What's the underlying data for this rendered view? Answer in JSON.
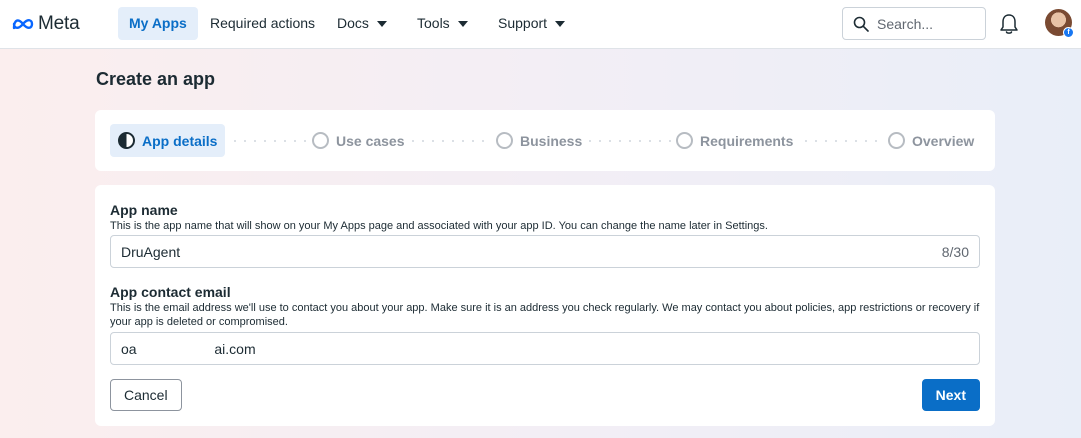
{
  "nav": {
    "brand": "Meta",
    "items": [
      {
        "label": "My Apps",
        "active": true,
        "dropdown": false
      },
      {
        "label": "Required actions",
        "active": false,
        "dropdown": false
      },
      {
        "label": "Docs",
        "active": false,
        "dropdown": true
      },
      {
        "label": "Tools",
        "active": false,
        "dropdown": true
      },
      {
        "label": "Support",
        "active": false,
        "dropdown": true
      }
    ],
    "search_placeholder": "Search...",
    "icons": [
      "meta-logo-icon",
      "search-icon",
      "bell-icon",
      "avatar"
    ]
  },
  "page": {
    "title": "Create an app"
  },
  "stepper": {
    "steps": [
      {
        "label": "App details",
        "state": "in-progress"
      },
      {
        "label": "Use cases",
        "state": "pending"
      },
      {
        "label": "Business",
        "state": "pending"
      },
      {
        "label": "Requirements",
        "state": "pending"
      },
      {
        "label": "Overview",
        "state": "pending"
      }
    ]
  },
  "form": {
    "app_name": {
      "label": "App name",
      "help": "This is the app name that will show on your My Apps page and associated with your app ID. You can change the name later in Settings.",
      "value": "DruAgent",
      "counter": "8/30"
    },
    "contact_email": {
      "label": "App contact email",
      "help": "This is the email address we'll use to contact you about your app. Make sure it is an address you check regularly. We may contact you about policies, app restrictions or recovery if your app is deleted or compromised.",
      "value": "oa                    ai.com"
    },
    "cancel_label": "Cancel",
    "next_label": "Next"
  },
  "colors": {
    "accent": "#0a6ec7",
    "active_bg": "#e4eefa",
    "text": "#1c2b33",
    "muted": "#8d949e"
  }
}
